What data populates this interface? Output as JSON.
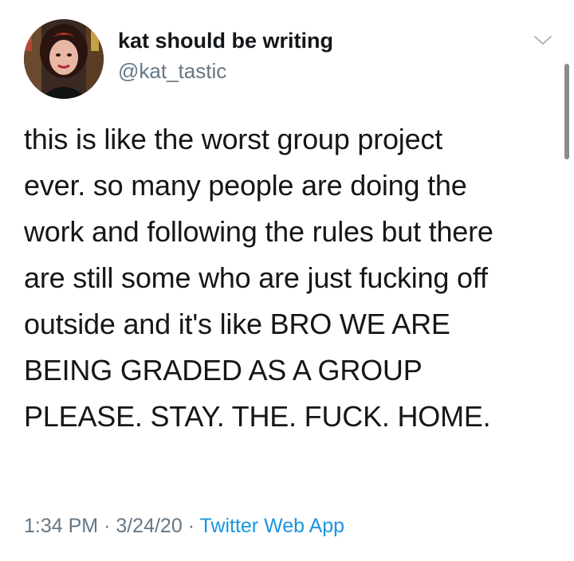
{
  "author": {
    "display_name": "kat should be writing",
    "handle": "@kat_tastic"
  },
  "tweet": {
    "lines": [
      "this is like the worst group project",
      "ever. so many people are doing the",
      "work and following the rules but there",
      "are still some who are just fucking off",
      "outside and it's like BRO WE ARE",
      "BEING GRADED AS A GROUP",
      "PLEASE. STAY. THE. FUCK. HOME."
    ]
  },
  "meta": {
    "time": "1:34 PM",
    "separator1": " · ",
    "date": "3/24/20",
    "separator2": " · ",
    "source": "Twitter Web App"
  },
  "icons": {
    "caret": "chevron-down-icon",
    "avatar": "avatar"
  },
  "colors": {
    "text": "#14171a",
    "secondary": "#657786",
    "link": "#1b95e0",
    "background": "#ffffff"
  }
}
